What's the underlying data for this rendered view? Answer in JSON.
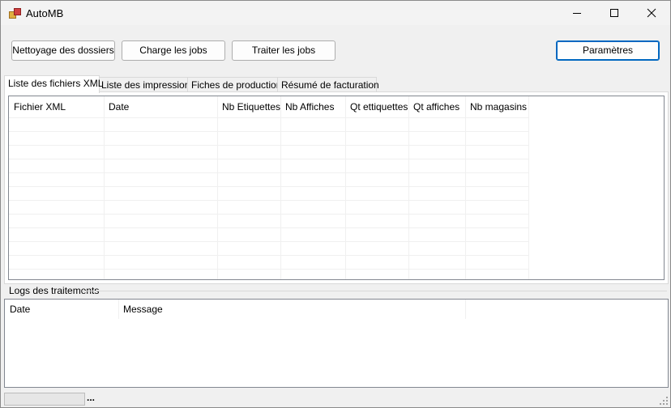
{
  "window": {
    "title": "AutoMB"
  },
  "toolbar": {
    "buttons": [
      "Nettoyage des dossiers",
      "Charge les jobs",
      "Traiter les jobs"
    ],
    "settings_label": "Paramètres"
  },
  "tabs": [
    "Liste des fichiers XML",
    "Liste des impressions",
    "Fiches de production",
    "Résumé de facturation"
  ],
  "xml_grid": {
    "columns": [
      "Fichier XML",
      "Date",
      "Nb Etiquettes",
      "Nb Affiches",
      "Qt ettiquettes",
      "Qt affiches",
      "Nb magasins"
    ],
    "rows": []
  },
  "logs": {
    "group_label": "Logs des traitements",
    "columns": [
      "Date",
      "Message"
    ],
    "rows": []
  },
  "status": {
    "text": "...",
    "progress": 0
  }
}
